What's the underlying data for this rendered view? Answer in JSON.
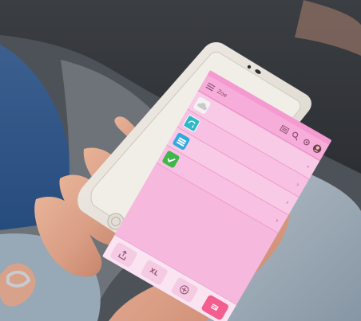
{
  "app": {
    "title": "Zoe",
    "items": [
      {
        "title": "",
        "subtitle": "",
        "color": "#f2f2f2",
        "icon": "cloud-icon"
      },
      {
        "title": "",
        "subtitle": "",
        "color": "#2fb8c7",
        "icon": "gj-icon"
      },
      {
        "title": "",
        "subtitle": "",
        "color": "#32a9e0",
        "icon": "bars-icon"
      },
      {
        "title": "",
        "subtitle": "",
        "color": "#40b74b",
        "icon": "check-icon"
      }
    ],
    "bottom_labels": {
      "xl": "XL"
    },
    "colors": {
      "screen": "#f7b8de",
      "accent": "#f35d8f"
    }
  }
}
